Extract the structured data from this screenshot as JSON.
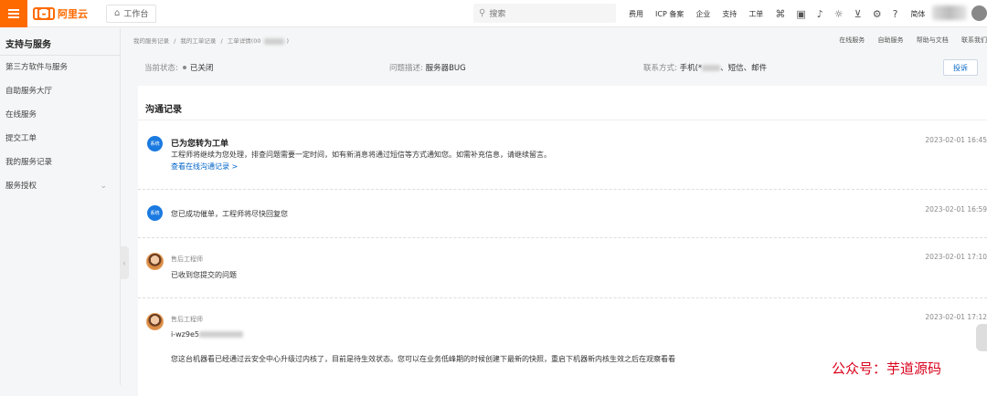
{
  "topbar": {
    "logo_mark": "[-]",
    "logo_text": "阿里云",
    "workbench": "工作台",
    "search_placeholder": "搜索",
    "nav": [
      "费用",
      "ICP 备案",
      "企业",
      "支持",
      "工单"
    ],
    "lang": "简体"
  },
  "sidebar": {
    "title": "支持与服务",
    "items": [
      {
        "label": "第三方软件与服务"
      },
      {
        "label": "自助服务大厅"
      },
      {
        "label": "在线服务"
      },
      {
        "label": "提交工单"
      },
      {
        "label": "我的服务记录"
      },
      {
        "label": "服务授权"
      }
    ]
  },
  "breadcrumb": [
    "我的服务记录",
    "/",
    "我的工单记录",
    "/",
    "工单详情(00"
  ],
  "toplinks": [
    "在线服务",
    "自助服务",
    "帮助与文档",
    "联系我们"
  ],
  "info": {
    "status_label": "当前状态:",
    "status_value": "已关闭",
    "desc_label": "问题描述:",
    "desc_value": "服务器BUG",
    "contact_label": "联系方式:",
    "contact_value_prefix": "手机(*",
    "contact_value_suffix": "、短信、邮件",
    "complain_button": "投诉"
  },
  "panel_title": "沟通记录",
  "records": [
    {
      "badge": "系统",
      "title": "已为您转为工单",
      "body": "工程师将继续为您处理，排查问题需要一定时间，如有新消息将通过短信等方式通知您。如需补充信息，请继续留言。",
      "link": "查看在线沟通记录 >",
      "time": "2023-02-01 16:45"
    },
    {
      "badge": "系统",
      "body": "您已成功催单，工程师将尽快回复您",
      "time": "2023-02-01 16:59"
    },
    {
      "author": "售后工程师",
      "body": "已收到您提交的问题",
      "time": "2023-02-01 17:10"
    },
    {
      "author": "售后工程师",
      "body_prefix": "i-wz9e5",
      "body": "您这台机器看已经通过云安全中心升级过内核了，目前是待生效状态。您可以在业务低峰期的时候创建下最新的快照，重启下机器新内核生效之后在观察看看",
      "time": "2023-02-01 17:12"
    }
  ],
  "watermark": "公众号：芋道源码"
}
